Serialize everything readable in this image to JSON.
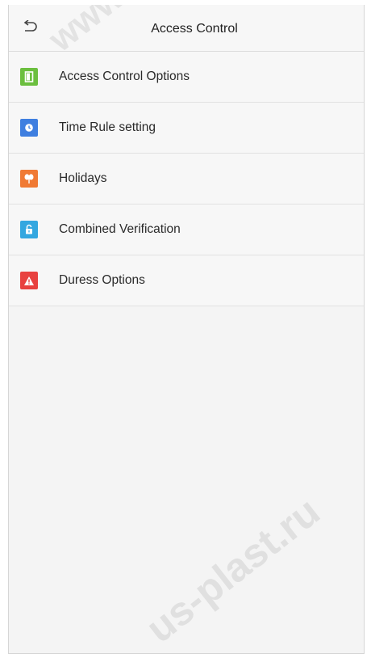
{
  "header": {
    "title": "Access Control"
  },
  "menu": {
    "items": [
      {
        "label": "Access Control Options",
        "icon": "door-icon",
        "color": "#6cbf3f"
      },
      {
        "label": "Time Rule setting",
        "icon": "clock-icon",
        "color": "#3f7fe0"
      },
      {
        "label": "Holidays",
        "icon": "holiday-icon",
        "color": "#f07a34"
      },
      {
        "label": "Combined Verification",
        "icon": "unlock-icon",
        "color": "#33a7e0"
      },
      {
        "label": "Duress Options",
        "icon": "warning-icon",
        "color": "#e8413f"
      }
    ]
  },
  "watermarks": {
    "top": "www",
    "bottom": "us-plast.ru"
  }
}
